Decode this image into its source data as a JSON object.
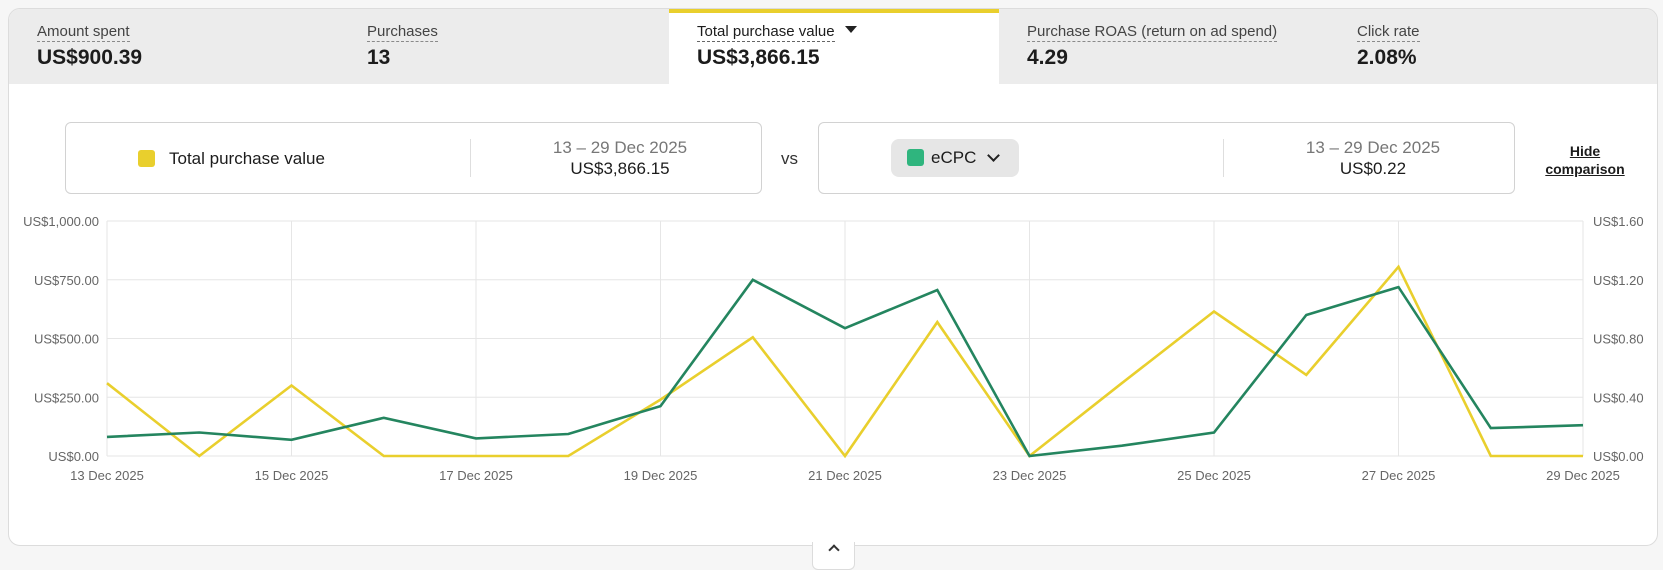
{
  "metrics": [
    {
      "label": "Amount spent",
      "value": "US$900.39"
    },
    {
      "label": "Purchases",
      "value": "13"
    },
    {
      "label": "Total purchase value",
      "value": "US$3,866.15",
      "active": true
    },
    {
      "label": "Purchase ROAS (return on ad spend)",
      "value": "4.29"
    },
    {
      "label": "Click rate",
      "value": "2.08%"
    }
  ],
  "comparison": {
    "primary": {
      "name": "Total purchase value",
      "date_range": "13 – 29 Dec 2025",
      "value": "US$3,866.15",
      "color": "#e9cf2d"
    },
    "vs_label": "vs",
    "secondary": {
      "name": "eCPC",
      "date_range": "13 – 29 Dec 2025",
      "value": "US$0.22",
      "color": "#2fb57e"
    },
    "hide_label": "Hide comparison"
  },
  "chart_data": {
    "type": "line",
    "x": [
      "13 Dec 2025",
      "14 Dec 2025",
      "15 Dec 2025",
      "16 Dec 2025",
      "17 Dec 2025",
      "18 Dec 2025",
      "19 Dec 2025",
      "20 Dec 2025",
      "21 Dec 2025",
      "22 Dec 2025",
      "23 Dec 2025",
      "24 Dec 2025",
      "25 Dec 2025",
      "26 Dec 2025",
      "27 Dec 2025",
      "28 Dec 2025",
      "29 Dec 2025"
    ],
    "x_tick_labels": [
      "13 Dec 2025",
      "15 Dec 2025",
      "17 Dec 2025",
      "19 Dec 2025",
      "21 Dec 2025",
      "23 Dec 2025",
      "25 Dec 2025",
      "27 Dec 2025",
      "29 Dec 2025"
    ],
    "y_left_ticks": [
      "US$0.00",
      "US$250.00",
      "US$500.00",
      "US$750.00",
      "US$1,000.00"
    ],
    "y_right_ticks": [
      "US$0.00",
      "US$0.40",
      "US$0.80",
      "US$1.20",
      "US$1.60"
    ],
    "ylim_left": [
      0,
      1000
    ],
    "ylim_right": [
      0,
      1.6
    ],
    "grid": true,
    "series": [
      {
        "name": "Total purchase value",
        "axis": "left",
        "color": "#e9cf2d",
        "values": [
          310,
          0,
          300,
          0,
          0,
          0,
          240,
          505,
          0,
          570,
          0,
          310,
          615,
          345,
          805,
          0,
          0
        ]
      },
      {
        "name": "eCPC",
        "axis": "right",
        "color": "#24855f",
        "values": [
          0.13,
          0.16,
          0.11,
          0.26,
          0.12,
          0.15,
          0.34,
          1.2,
          0.87,
          1.13,
          0,
          0.07,
          0.16,
          0.96,
          1.15,
          0.19,
          0.21
        ]
      }
    ]
  }
}
